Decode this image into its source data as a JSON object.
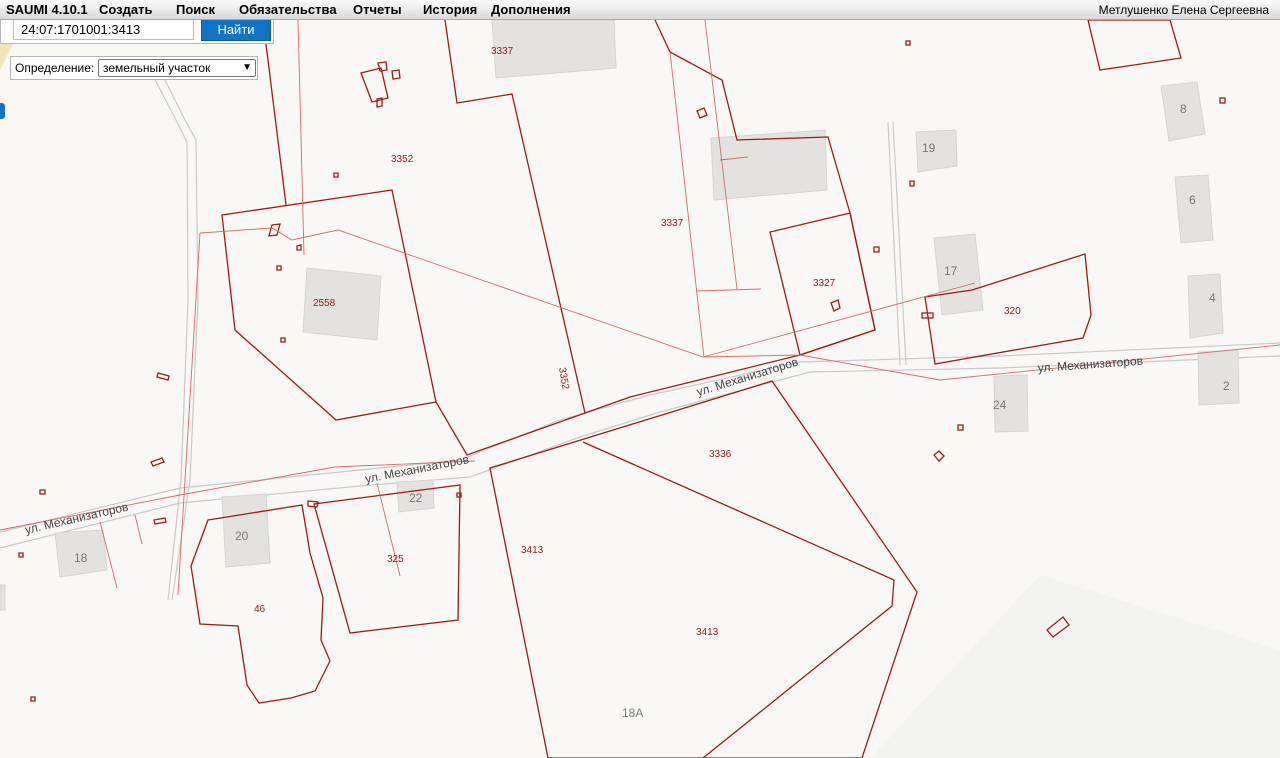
{
  "menubar": {
    "app_title": "SAUMI 4.10.1",
    "items": [
      {
        "label": "Создать"
      },
      {
        "label": "Поиск"
      },
      {
        "label": "Обязательства"
      },
      {
        "label": "Отчеты"
      },
      {
        "label": "История"
      },
      {
        "label": "Дополнения"
      }
    ],
    "user_name": "Метлушенко Елена Сергеевна"
  },
  "search": {
    "value": "24:07:1701001:3413",
    "button_label": "Найти"
  },
  "definition": {
    "label": "Определение:",
    "selected": "земельный участок"
  },
  "map": {
    "parcel_labels": [
      "3337",
      "3352",
      "3337",
      "3327",
      "2558",
      "320",
      "3352",
      "3336",
      "3413",
      "3413",
      "325",
      "46"
    ],
    "house_numbers": [
      "8",
      "19",
      "6",
      "17",
      "4",
      "24",
      "2",
      "22",
      "20",
      "18",
      "18А"
    ],
    "street_names": [
      "ул. Механизаторов",
      "ул. Механизаторов",
      "ул. Механизаторов",
      "ул. Механизаторов"
    ]
  },
  "colors": {
    "parcel_border": "#9b1b1b",
    "accent_button": "#1173c3",
    "map_background": "#f9f8f4",
    "building_fill": "#e3e2df"
  }
}
